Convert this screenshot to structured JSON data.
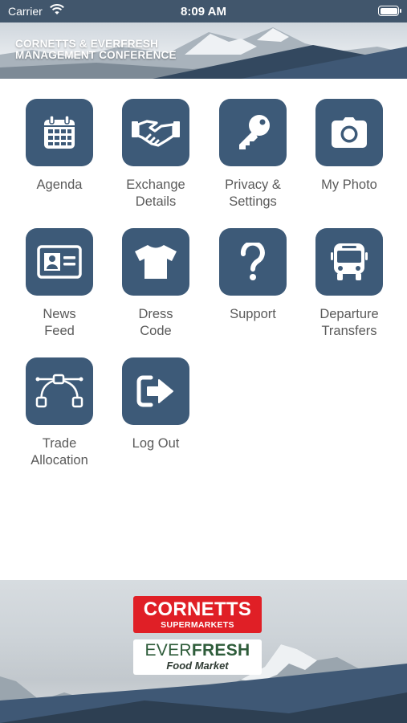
{
  "status_bar": {
    "carrier": "Carrier",
    "time": "8:09 AM",
    "icons": [
      "wifi-icon",
      "battery-icon"
    ]
  },
  "header": {
    "title_line1": "CORNETTS & EVERFRESH",
    "title_line2": "MANAGEMENT CONFERENCE"
  },
  "menu": {
    "items": [
      {
        "line1": "Agenda",
        "line2": "",
        "icon": "calendar-icon"
      },
      {
        "line1": "Exchange",
        "line2": "Details",
        "icon": "handshake-icon"
      },
      {
        "line1": "Privacy &",
        "line2": "Settings",
        "icon": "key-icon"
      },
      {
        "line1": "My Photo",
        "line2": "",
        "icon": "camera-icon"
      },
      {
        "line1": "News",
        "line2": "Feed",
        "icon": "id-card-icon"
      },
      {
        "line1": "Dress",
        "line2": "Code",
        "icon": "tshirt-icon"
      },
      {
        "line1": "Support",
        "line2": "",
        "icon": "question-icon"
      },
      {
        "line1": "Departure",
        "line2": "Transfers",
        "icon": "bus-icon"
      },
      {
        "line1": "Trade",
        "line2": "Allocation",
        "icon": "vector-path-icon"
      },
      {
        "line1": "Log Out",
        "line2": "",
        "icon": "logout-icon"
      }
    ]
  },
  "footer": {
    "logo1_main": "CORNETTS",
    "logo1_sub": "SUPERMARKETS",
    "logo2_ever": "EVER",
    "logo2_fresh": "FRESH",
    "logo2_sub": "Food Market"
  },
  "colors": {
    "status_bar": "#41566c",
    "tile": "#3d5a78",
    "label_text": "#5a5a5a",
    "cornetts_red": "#e01f26"
  }
}
